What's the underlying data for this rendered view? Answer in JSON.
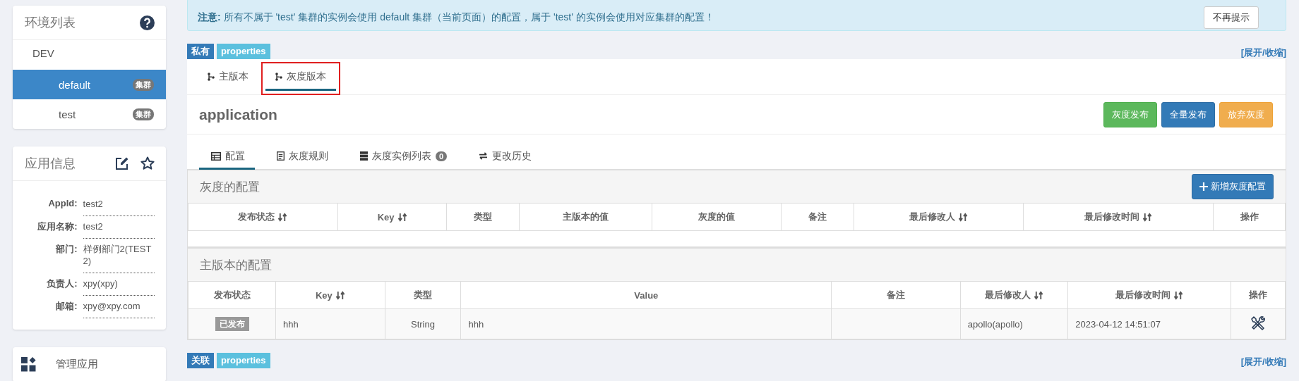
{
  "sidebar": {
    "environments": {
      "title": "环境列表",
      "items": [
        {
          "name": "DEV",
          "children": [
            {
              "name": "default",
              "badge": "集群",
              "selected": true
            },
            {
              "name": "test",
              "badge": "集群",
              "selected": false
            }
          ]
        }
      ]
    },
    "app_info": {
      "title": "应用信息",
      "fields": [
        {
          "label": "AppId:",
          "value": "test2"
        },
        {
          "label": "应用名称:",
          "value": "test2"
        },
        {
          "label": "部门:",
          "value": "样例部门2(TEST2)"
        },
        {
          "label": "负责人:",
          "value": "xpy(xpy)"
        },
        {
          "label": "邮箱:",
          "value": "xpy@xpy.com"
        }
      ]
    },
    "manage": {
      "label": "管理应用"
    }
  },
  "alert": {
    "text": "**注意:** 所有不属于 'test' 集群的实例会使用 default 集群（当前页面）的配置，属于 'test' 的实例会使用对应集群的配置！",
    "button": "不再提示"
  },
  "namespaces": [
    {
      "tags": [
        {
          "label": "私有",
          "kind": "scope"
        },
        {
          "label": "properties",
          "kind": "format"
        }
      ],
      "toggle": "[展开/收缩]",
      "branch_tabs": [
        {
          "label": "主版本",
          "selected": false
        },
        {
          "label": "灰度版本",
          "selected": true
        }
      ],
      "title": "application",
      "actions": [
        {
          "label": "灰度发布",
          "kind": "success"
        },
        {
          "label": "全量发布",
          "kind": "primary"
        },
        {
          "label": "放弃灰度",
          "kind": "warning"
        }
      ],
      "sub_tabs": [
        {
          "label": "配置",
          "kind": "table",
          "selected": true
        },
        {
          "label": "灰度规则",
          "kind": "rules",
          "selected": false
        },
        {
          "label": "灰度实例列表",
          "kind": "instances",
          "count": "0",
          "selected": false
        },
        {
          "label": "更改历史",
          "kind": "history",
          "selected": false
        }
      ],
      "gray_config": {
        "title": "灰度的配置",
        "button": "新增灰度配置",
        "columns": [
          {
            "label": "发布状态",
            "sortable": true
          },
          {
            "label": "Key",
            "sortable": true
          },
          {
            "label": "类型",
            "sortable": false
          },
          {
            "label": "主版本的值",
            "sortable": false
          },
          {
            "label": "灰度的值",
            "sortable": false
          },
          {
            "label": "备注",
            "sortable": false
          },
          {
            "label": "最后修改人",
            "sortable": true
          },
          {
            "label": "最后修改时间",
            "sortable": true
          },
          {
            "label": "操作",
            "sortable": false
          }
        ]
      },
      "main_config": {
        "title": "主版本的配置",
        "columns": [
          {
            "label": "发布状态",
            "sortable": false,
            "kind": "status"
          },
          {
            "label": "Key",
            "sortable": true,
            "kind": "text"
          },
          {
            "label": "类型",
            "sortable": false,
            "kind": "center"
          },
          {
            "label": "Value",
            "sortable": false,
            "kind": "text"
          },
          {
            "label": "备注",
            "sortable": false,
            "kind": "text"
          },
          {
            "label": "最后修改人",
            "sortable": true,
            "kind": "text"
          },
          {
            "label": "最后修改时间",
            "sortable": true,
            "kind": "text"
          },
          {
            "label": "操作",
            "sortable": false,
            "kind": "action"
          }
        ],
        "rows": [
          {
            "cells": [
              "已发布",
              "hhh",
              "String",
              "hhh",
              null,
              "apollo(apollo)",
              "2023-04-12 14:51:07",
              null
            ]
          }
        ]
      }
    },
    {
      "tags": [
        {
          "label": "关联",
          "kind": "scope"
        },
        {
          "label": "properties",
          "kind": "format"
        }
      ],
      "toggle": "[展开/收缩]"
    }
  ]
}
